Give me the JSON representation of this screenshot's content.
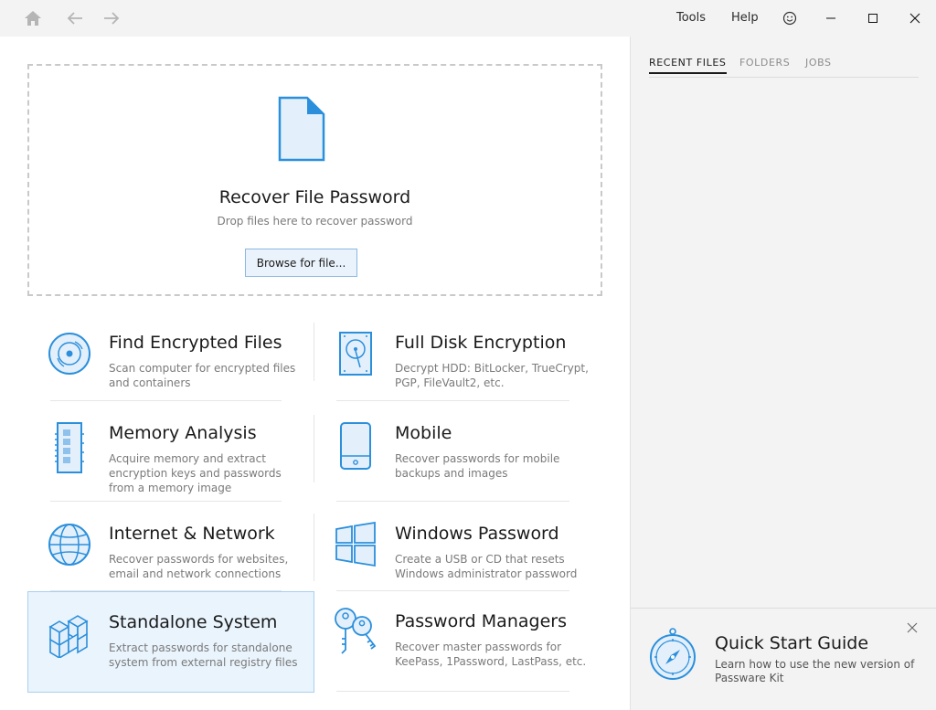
{
  "titlebar": {
    "menu_tools": "Tools",
    "menu_help": "Help",
    "icons": [
      "home-icon",
      "back-arrow-icon",
      "forward-arrow-icon",
      "smiley-feedback-icon",
      "minimize-icon",
      "maximize-icon",
      "close-icon"
    ]
  },
  "dropzone": {
    "title": "Recover File Password",
    "subtitle": "Drop files here to recover password",
    "browse_label": "Browse for file..."
  },
  "tiles": [
    {
      "title": "Find Encrypted Files",
      "desc": "Scan computer for encrypted files and containers",
      "icon": "disc-scan-icon"
    },
    {
      "title": "Full Disk Encryption",
      "desc": "Decrypt HDD: BitLocker, TrueCrypt, PGP, FileVault2, etc.",
      "icon": "hard-disk-icon"
    },
    {
      "title": "Memory Analysis",
      "desc": "Acquire memory and extract encryption keys and passwords from a memory image",
      "icon": "memory-stick-icon"
    },
    {
      "title": "Mobile",
      "desc": "Recover passwords for mobile backups and images",
      "icon": "mobile-phone-icon"
    },
    {
      "title": "Internet & Network",
      "desc": "Recover passwords for websites, email and network connections",
      "icon": "globe-icon"
    },
    {
      "title": "Windows Password",
      "desc": "Create a USB or CD that resets Windows administrator password",
      "icon": "windows-logo-icon"
    },
    {
      "title": "Standalone System",
      "desc": "Extract passwords for standalone system from external registry files",
      "icon": "cubes-icon"
    },
    {
      "title": "Password Managers",
      "desc": "Recover master passwords for KeePass, 1Password, LastPass, etc.",
      "icon": "keys-icon"
    }
  ],
  "sidebar": {
    "tabs": [
      "RECENT FILES",
      "FOLDERS",
      "JOBS"
    ],
    "active_tab": "RECENT FILES"
  },
  "quick_start": {
    "title": "Quick Start Guide",
    "desc": "Learn how to use the new version of Passware Kit",
    "icon": "compass-icon"
  },
  "colors": {
    "accent": "#2b8fdc",
    "accent_light": "#e3f0fb",
    "selected_bg": "#eaf4fd",
    "sidebar_bg": "#f3f3f3"
  }
}
